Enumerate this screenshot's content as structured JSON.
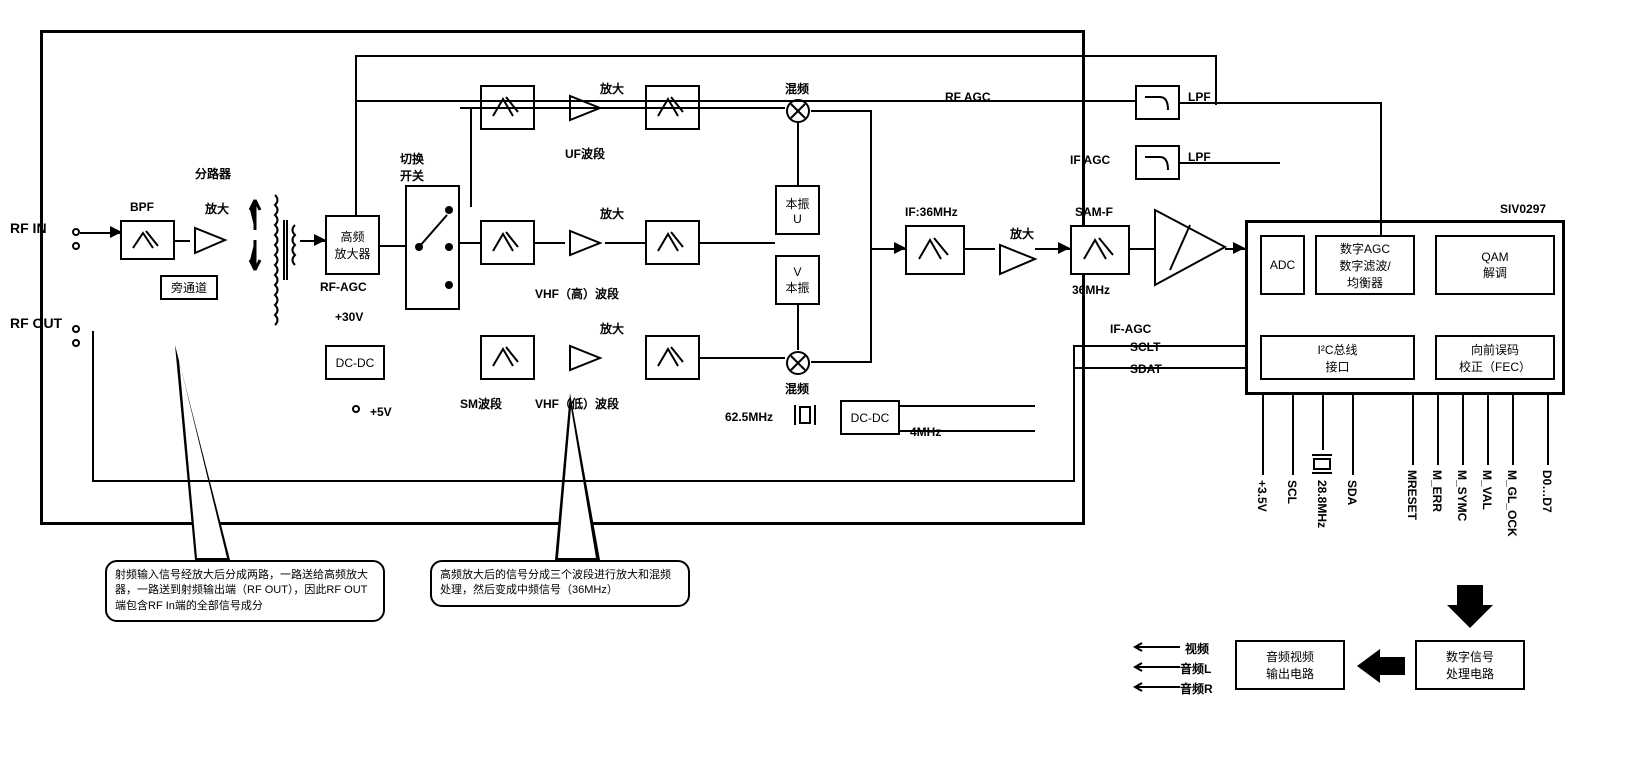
{
  "ports": {
    "rf_in": "RF IN",
    "rf_out": "RF OUT"
  },
  "blocks": {
    "bpf": "BPF",
    "amp1": "放大",
    "splitter": "分路器",
    "bypass": "旁通道",
    "rf_agc_amp": "高频\n放大器",
    "rf_agc_label": "RF-AGC",
    "switch": "切换\n开关",
    "dc_dc_30v": "DC-DC",
    "plus30v": "+30V",
    "plus5v": "+5V",
    "amp_label": "放大",
    "mixer_top": "混频",
    "mixer_bottom": "混频",
    "uf_band": "UF波段",
    "vhf_high": "VHF（高）波段",
    "sm_band": "SM波段",
    "vhf_low": "VHF（低）波段",
    "lo_u": "本振\nU",
    "lo_v": "V\n本振",
    "if_36": "IF:36MHz",
    "sam_f": "SAM-F",
    "mhz_36": "36MHz",
    "rf_agc": "RF AGC",
    "if_agc": "IF AGC",
    "if_agc_pin": "IF-AGC",
    "lpf1": "LPF",
    "lpf2": "LPF",
    "adc": "ADC",
    "dagc": "数字AGC\n数字滤波/\n均衡器",
    "qam": "QAM\n解调",
    "i2c": "I²C总线\n接口",
    "fec": "向前误码\n校正（FEC）",
    "chip": "SIV0297",
    "sclt": "SCLT",
    "sdat": "SDAT",
    "dc_dc2": "DC-DC",
    "f625": "62.5MHz",
    "f4": "4MHz",
    "xtal": "28.8MHz",
    "av_output": "音频视频\n输出电路",
    "dsp": "数字信号\n处理电路",
    "video": "视频",
    "audio_l": "音频L",
    "audio_r": "音频R"
  },
  "pins": {
    "p35v": "+3.5V",
    "scl": "SCL",
    "sda": "SDA",
    "mreset": "MRESET",
    "merr": "M_ERR",
    "msymc": "M_SYMC",
    "mval": "M_VAL",
    "mglock": "M_GL_OCK",
    "d0d7": "D0…D7"
  },
  "callouts": {
    "c1": "射频输入信号经放大后分成两路，一路送给高频放大器，一路送到射频输出端（RF OUT），因此RF OUT端包含RF In端的全部信号成分",
    "c2": "高频放大后的信号分成三个波段进行放大和混频处理，然后变成中频信号（36MHz）"
  }
}
